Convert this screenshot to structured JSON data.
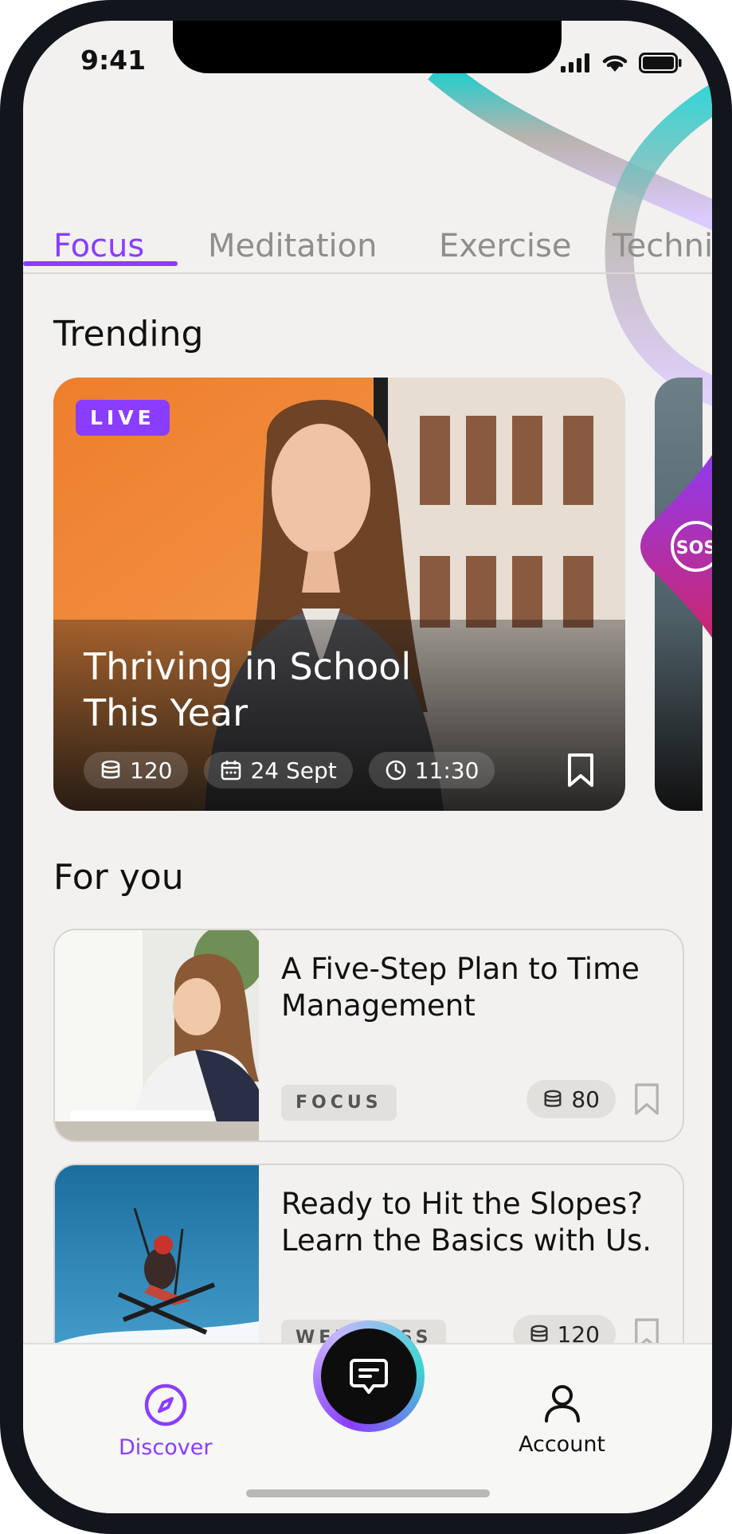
{
  "status_bar": {
    "time": "9:41"
  },
  "tabs": [
    {
      "label": "Focus",
      "active": true
    },
    {
      "label": "Meditation",
      "active": false
    },
    {
      "label": "Exercise",
      "active": false
    },
    {
      "label": "Techni",
      "active": false
    }
  ],
  "trending": {
    "title": "Trending",
    "card": {
      "badge": "LIVE",
      "title": "Thriving in School This Year",
      "coins": "120",
      "date": "24 Sept",
      "time": "11:30"
    }
  },
  "sos_label": "SOS",
  "for_you": {
    "title": "For you",
    "items": [
      {
        "title": "A Five-Step Plan to Time Management",
        "tag": "FOCUS",
        "coins": "80"
      },
      {
        "title": "Ready to Hit the Slopes? Learn the Basics with Us.",
        "tag": "WELLNESS",
        "coins": "120"
      }
    ]
  },
  "nav": {
    "discover_label": "Discover",
    "account_label": "Account"
  },
  "colors": {
    "accent": "#8a3dff",
    "background": "#f2f1ef",
    "teal": "#3dd6d0"
  },
  "icons": [
    "compass-icon",
    "chat-icon",
    "user-icon",
    "bookmark-icon",
    "coins-icon",
    "calendar-icon",
    "clock-icon",
    "sos-icon"
  ]
}
